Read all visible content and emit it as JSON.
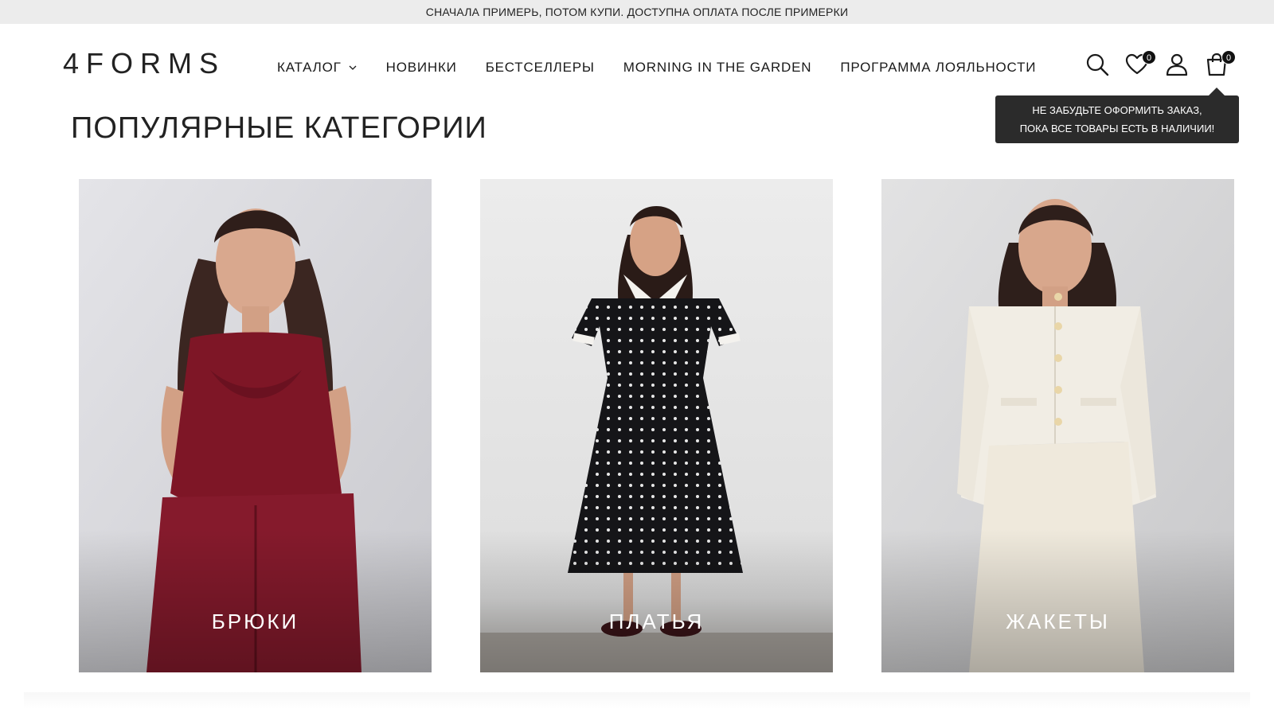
{
  "announcement": "СНАЧАЛА ПРИМЕРЬ, ПОТОМ КУПИ. ДОСТУПНА ОПЛАТА ПОСЛЕ ПРИМЕРКИ",
  "brand": {
    "logo_text": "4FORMS"
  },
  "nav": {
    "items": [
      {
        "label": "КАТАЛОГ",
        "has_dropdown": true
      },
      {
        "label": "НОВИНКИ"
      },
      {
        "label": "БЕСТСЕЛЛЕРЫ"
      },
      {
        "label": "MORNING IN THE GARDEN"
      },
      {
        "label": "ПРОГРАММА ЛОЯЛЬНОСТИ"
      }
    ]
  },
  "header_icons": {
    "search": "search-icon",
    "favorites": {
      "icon": "heart-icon",
      "count": "0"
    },
    "account": "user-icon",
    "cart": {
      "icon": "bag-icon",
      "count": "0"
    }
  },
  "tooltip": {
    "line1": "НЕ ЗАБУДЬТЕ ОФОРМИТЬ ЗАКАЗ,",
    "line2": "ПОКА ВСЕ ТОВАРЫ ЕСТЬ В НАЛИЧИИ!"
  },
  "section": {
    "title": "ПОПУЛЯРНЫЕ КАТЕГОРИИ"
  },
  "categories": [
    {
      "label": "БРЮКИ",
      "accent": "#8b1a2b"
    },
    {
      "label": "ПЛАТЬЯ",
      "accent": "#111111"
    },
    {
      "label": "ЖАКЕТЫ",
      "accent": "#f1ebdf"
    }
  ]
}
